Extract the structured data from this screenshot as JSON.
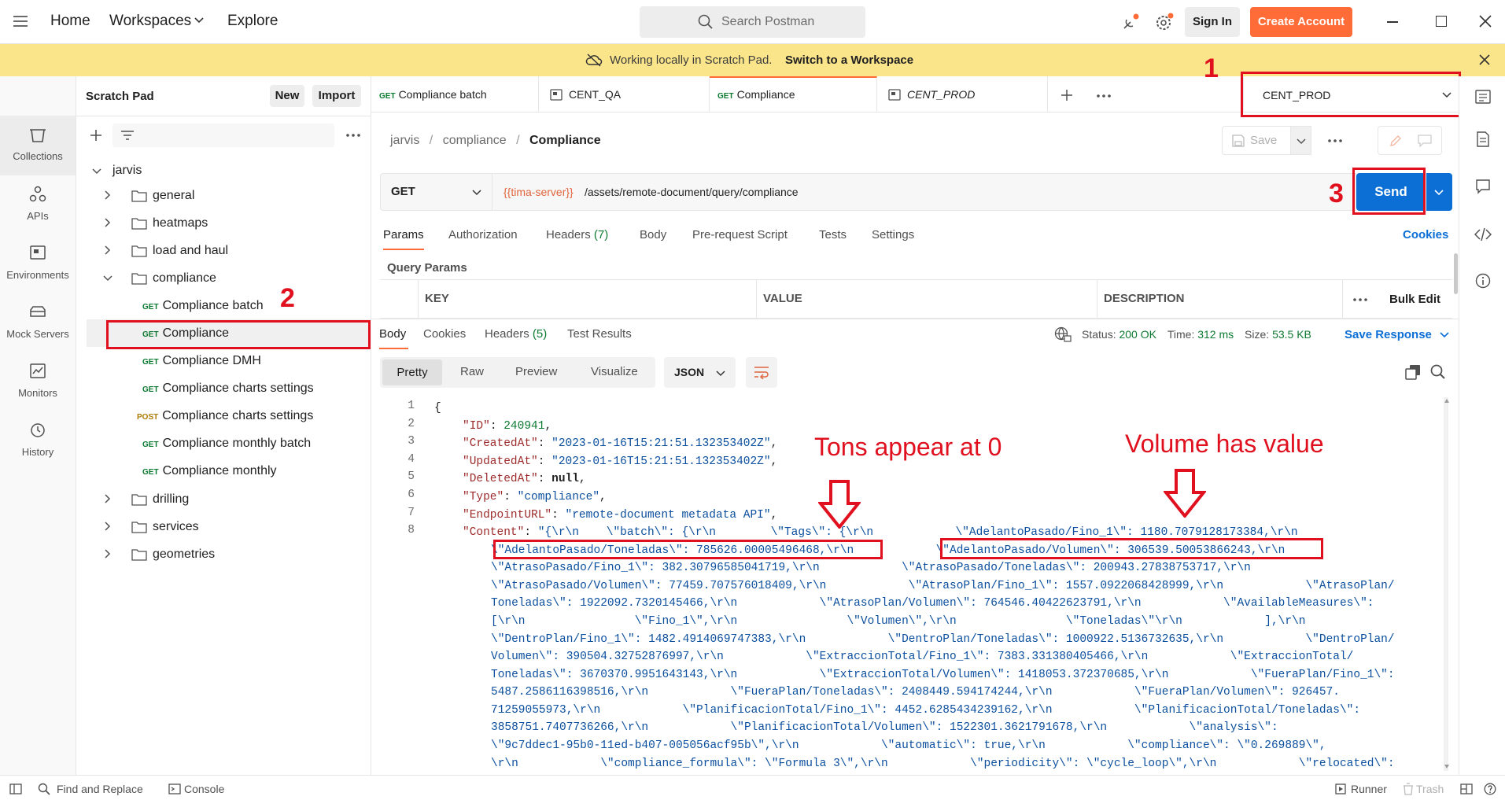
{
  "topbar": {
    "home": "Home",
    "workspaces": "Workspaces",
    "explore": "Explore",
    "search_placeholder": "Search Postman",
    "sign_in": "Sign In",
    "create_account": "Create Account"
  },
  "banner": {
    "text": "Working locally in Scratch Pad.",
    "link": "Switch to a Workspace"
  },
  "rail": {
    "items": [
      "Collections",
      "APIs",
      "Environments",
      "Mock Servers",
      "Monitors",
      "History"
    ]
  },
  "sidebar": {
    "title": "Scratch Pad",
    "new": "New",
    "import": "Import",
    "root": "jarvis",
    "folders_top": [
      "general",
      "heatmaps",
      "load and haul",
      "compliance"
    ],
    "requests": [
      {
        "method": "GET",
        "name": "Compliance batch"
      },
      {
        "method": "GET",
        "name": "Compliance"
      },
      {
        "method": "GET",
        "name": "Compliance DMH"
      },
      {
        "method": "GET",
        "name": "Compliance charts settings"
      },
      {
        "method": "POST",
        "name": "Compliance charts settings"
      },
      {
        "method": "GET",
        "name": "Compliance monthly batch"
      },
      {
        "method": "GET",
        "name": "Compliance monthly"
      }
    ],
    "folders_bottom": [
      "drilling",
      "services",
      "geometries"
    ]
  },
  "tabs": [
    {
      "method": "GET",
      "name": "Compliance batch"
    },
    {
      "method": "",
      "name": "CENT_QA"
    },
    {
      "method": "GET",
      "name": "Compliance"
    },
    {
      "method": "",
      "name": "CENT_PROD"
    }
  ],
  "environment": "CENT_PROD",
  "breadcrumb": {
    "a": "jarvis",
    "b": "compliance",
    "c": "Compliance"
  },
  "save": "Save",
  "request": {
    "method": "GET",
    "url_var": "{{tima-server}}",
    "url_path": "/assets/remote-document/query/compliance",
    "send": "Send"
  },
  "req_tabs": {
    "params": "Params",
    "auth": "Authorization",
    "headers": "Headers",
    "headers_count": "(7)",
    "body": "Body",
    "prereq": "Pre-request Script",
    "tests": "Tests",
    "settings": "Settings",
    "cookies": "Cookies"
  },
  "query_params": "Query Params",
  "table": {
    "key": "KEY",
    "value": "VALUE",
    "description": "DESCRIPTION",
    "bulk": "Bulk Edit"
  },
  "resp_tabs": {
    "body": "Body",
    "cookies": "Cookies",
    "headers": "Headers",
    "headers_count": "(5)",
    "results": "Test Results"
  },
  "resp_status": {
    "status_label": "Status:",
    "status": "200 OK",
    "time_label": "Time:",
    "time": "312 ms",
    "size_label": "Size:",
    "size": "53.5 KB",
    "save": "Save Response"
  },
  "view": {
    "pretty": "Pretty",
    "raw": "Raw",
    "preview": "Preview",
    "visualize": "Visualize",
    "format": "JSON"
  },
  "annotations": {
    "n1": "1",
    "n2": "2",
    "n3": "3",
    "tons": "Tons appear at 0",
    "volume": "Volume has value"
  },
  "code": {
    "l1": "{",
    "l2k": "\"ID\"",
    "l2v": "240941",
    "l3k": "\"CreatedAt\"",
    "l3v": "\"2023-01-16T15:21:51.132353402Z\"",
    "l4k": "\"UpdatedAt\"",
    "l4v": "\"2023-01-16T15:21:51.132353402Z\"",
    "l5k": "\"DeletedAt\"",
    "l5v": "null",
    "l6k": "\"Type\"",
    "l6v": "\"compliance\"",
    "l7k": "\"EndpointURL\"",
    "l7v": "\"remote-document metadata API\"",
    "l8k": "\"Content\"",
    "l8v": "\"{\\r\\n    \\\"batch\\\": {\\r\\n        \\\"Tags\\\": {\\r\\n            \\\"AdelantoPasado/Fino_1\\\": 1180.7079128173384,\\r\\n",
    "w1": "\\\"AdelantoPasado/Toneladas\\\": 785626.00005496468,\\r\\n            \\\"AdelantoPasado/Volumen\\\": 306539.50053866243,\\r\\n",
    "w2": "\\\"AtrasoPasado/Fino_1\\\": 382.30796585041719,\\r\\n            \\\"AtrasoPasado/Toneladas\\\": 200943.27838753717,\\r\\n",
    "w3": "\\\"AtrasoPasado/Volumen\\\": 77459.707576018409,\\r\\n            \\\"AtrasoPlan/Fino_1\\\": 1557.0922068428999,\\r\\n            \\\"AtrasoPlan/",
    "w4": "Toneladas\\\": 1922092.7320145466,\\r\\n            \\\"AtrasoPlan/Volumen\\\": 764546.40422623791,\\r\\n            \\\"AvailableMeasures\\\":",
    "w5": "[\\r\\n                \\\"Fino_1\\\",\\r\\n                \\\"Volumen\\\",\\r\\n                \\\"Toneladas\\\"\\r\\n            ],\\r\\n",
    "w6": "\\\"DentroPlan/Fino_1\\\": 1482.4914069747383,\\r\\n            \\\"DentroPlan/Toneladas\\\": 1000922.5136732635,\\r\\n            \\\"DentroPlan/",
    "w7": "Volumen\\\": 390504.32752876997,\\r\\n            \\\"ExtraccionTotal/Fino_1\\\": 7383.331380405466,\\r\\n            \\\"ExtraccionTotal/",
    "w8": "Toneladas\\\": 3670370.9951643143,\\r\\n            \\\"ExtraccionTotal/Volumen\\\": 1418053.372370685,\\r\\n            \\\"FueraPlan/Fino_1\\\":",
    "w9": "5487.2586116398516,\\r\\n            \\\"FueraPlan/Toneladas\\\": 2408449.594174244,\\r\\n            \\\"FueraPlan/Volumen\\\": 926457.",
    "w10": "71259055973,\\r\\n            \\\"PlanificacionTotal/Fino_1\\\": 4452.6285434239162,\\r\\n            \\\"PlanificacionTotal/Toneladas\\\":",
    "w11": "3858751.7407736266,\\r\\n            \\\"PlanificacionTotal/Volumen\\\": 1522301.3621791678,\\r\\n            \\\"analysis\\\":",
    "w12": "\\\"9c7ddec1-95b0-11ed-b407-005056acf95b\\\",\\r\\n            \\\"automatic\\\": true,\\r\\n            \\\"compliance\\\": \\\"0.269889\\\",",
    "w13": "\\r\\n            \\\"compliance_formula\\\": \\\"Formula 3\\\",\\r\\n            \\\"periodicity\\\": \\\"cycle_loop\\\",\\r\\n            \\\"relocated\\\":"
  },
  "statusbar": {
    "find": "Find and Replace",
    "console": "Console",
    "runner": "Runner",
    "trash": "Trash"
  }
}
